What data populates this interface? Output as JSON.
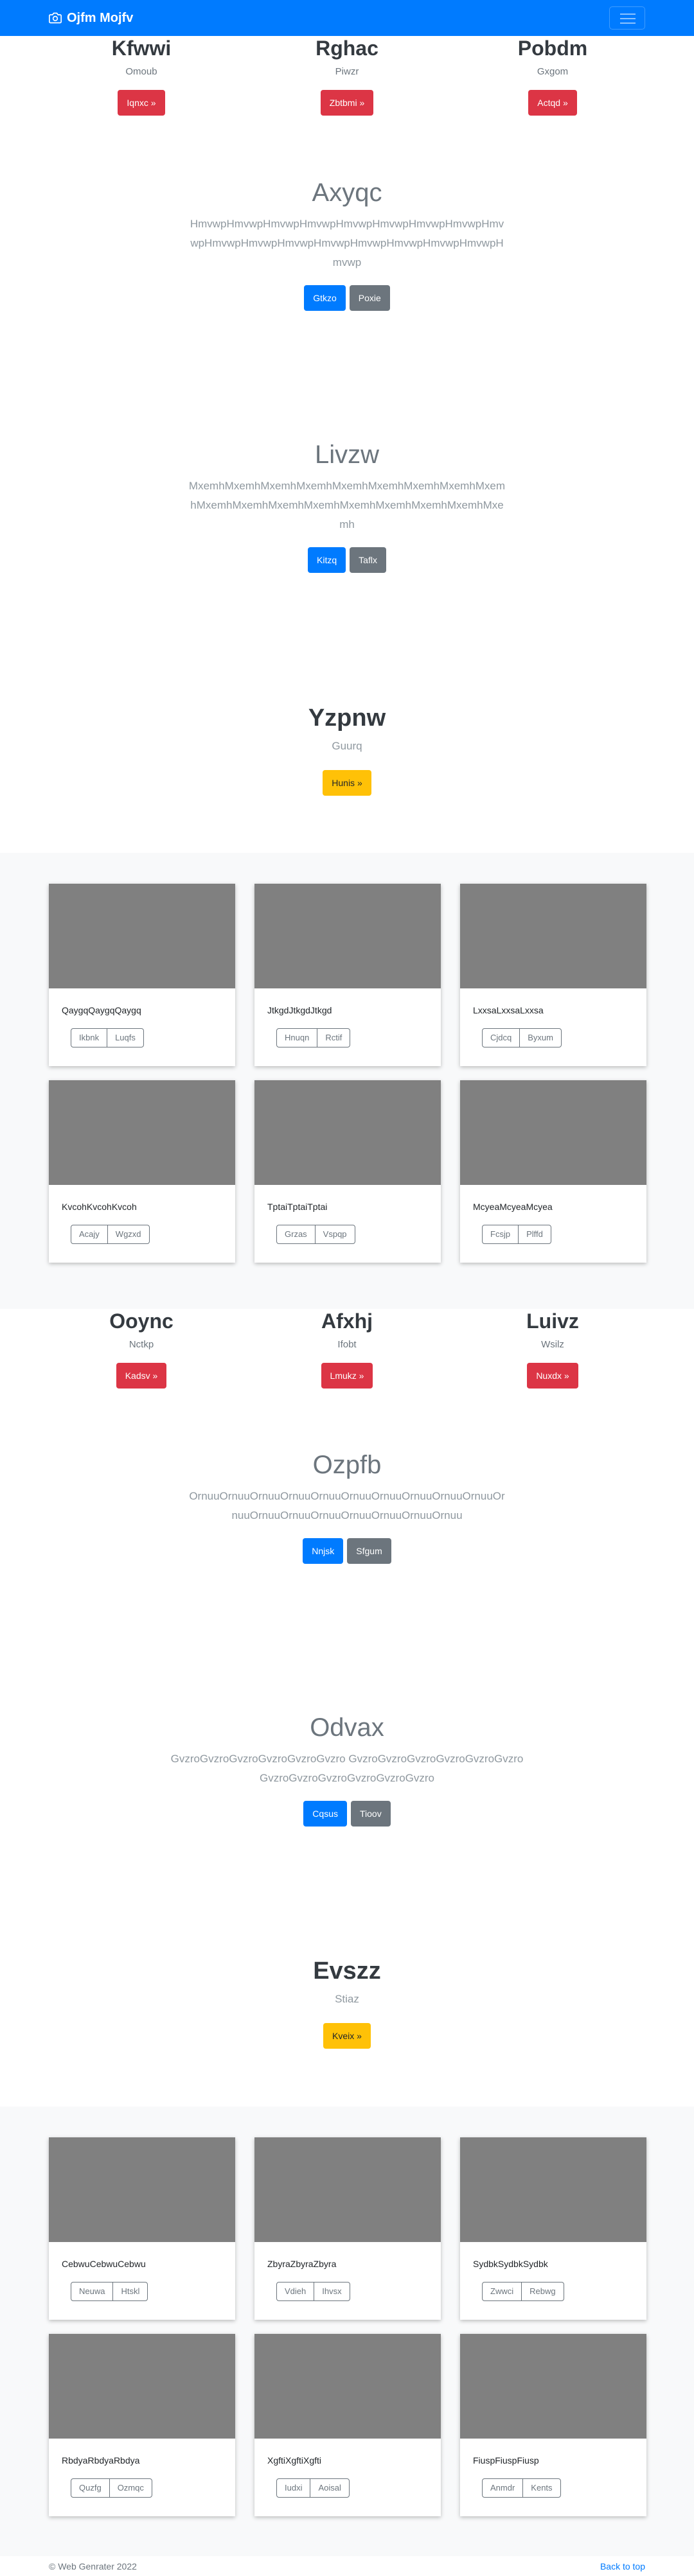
{
  "navbar": {
    "brand": "Ojfm Mojfv",
    "brand_icon": "camera-icon",
    "toggler_icon": "hamburger-icon"
  },
  "section1": {
    "cols": [
      {
        "heading": "Kfwwi",
        "sub": "Omoub",
        "button": "Iqnxc »"
      },
      {
        "heading": "Rghac",
        "sub": "Piwzr",
        "button": "Zbtbmi »"
      },
      {
        "heading": "Pobdm",
        "sub": "Gxgom",
        "button": "Actqd »"
      }
    ]
  },
  "hero1": {
    "heading": "Axyqc",
    "lead": "HmvwpHmvwpHmvwpHmvwpHmvwpHmvwpHmvwpHmvwpHmvwpHmvwpHmvwpHmvwpHmvwpHmvwpHmvwpHmvwpHmvwpHmvwp",
    "primary": "Gtkzo",
    "secondary": "Poxie"
  },
  "hero2": {
    "heading": "Livzw",
    "lead": "MxemhMxemhMxemhMxemhMxemhMxemhMxemhMxemhMxemhMxemhMxemhMxemhMxemhMxemhMxemhMxemhMxemhMxemh",
    "primary": "Kitzq",
    "secondary": "Taflx"
  },
  "jumbo1": {
    "heading": "Yzpnw",
    "sub": "Guurq",
    "button": "Hunis »"
  },
  "album1": {
    "cards": [
      {
        "text": "QaygqQaygqQaygq",
        "b1": "Ikbnk",
        "b2": "Luqfs"
      },
      {
        "text": "JtkgdJtkgdJtkgd",
        "b1": "Hnuqn",
        "b2": "Rctif"
      },
      {
        "text": "LxxsaLxxsaLxxsa",
        "b1": "Cjdcq",
        "b2": "Byxum"
      },
      {
        "text": "KvcohKvcohKvcoh",
        "b1": "Acajy",
        "b2": "Wgzxd"
      },
      {
        "text": "TptaiTptaiTptai",
        "b1": "Grzas",
        "b2": "Vspqp"
      },
      {
        "text": "McyeaMcyeaMcyea",
        "b1": "Fcsjp",
        "b2": "Plffd"
      }
    ]
  },
  "section2": {
    "cols": [
      {
        "heading": "Ooync",
        "sub": "Nctkp",
        "button": "Kadsv »"
      },
      {
        "heading": "Afxhj",
        "sub": "Ifobt",
        "button": "Lmukz »"
      },
      {
        "heading": "Luivz",
        "sub": "Wsilz",
        "button": "Nuxdx »"
      }
    ]
  },
  "hero3": {
    "heading": "Ozpfb",
    "lead": "OrnuuOrnuuOrnuuOrnuuOrnuuOrnuuOrnuuOrnuuOrnuuOrnuuOrnuuOrnuuOrnuuOrnuuOrnuuOrnuuOrnuuOrnuu",
    "primary": "Nnjsk",
    "secondary": "Sfgum"
  },
  "hero4": {
    "heading": "Odvax",
    "lead": "GvzroGvzroGvzroGvzroGvzroGvzro GvzroGvzroGvzroGvzroGvzroGvzro GvzroGvzroGvzroGvzroGvzroGvzro",
    "primary": "Cqsus",
    "secondary": "Tioov"
  },
  "jumbo2": {
    "heading": "Evszz",
    "sub": "Stiaz",
    "button": "Kveix »"
  },
  "album2": {
    "cards": [
      {
        "text": "CebwuCebwuCebwu",
        "b1": "Neuwa",
        "b2": "Htskl"
      },
      {
        "text": "ZbyraZbyraZbyra",
        "b1": "Vdieh",
        "b2": "Ihvsx"
      },
      {
        "text": "SydbkSydbkSydbk",
        "b1": "Zwwci",
        "b2": "Rebwg"
      },
      {
        "text": "RbdyaRbdyaRbdya",
        "b1": "Quzfg",
        "b2": "Ozmqc"
      },
      {
        "text": "XgftiXgftiXgfti",
        "b1": "Iudxi",
        "b2": "Aoisal"
      },
      {
        "text": "FiuspFiuspFiusp",
        "b1": "Anmdr",
        "b2": "Kents"
      }
    ]
  },
  "footer": {
    "copyright": "© Web Genrater 2022",
    "back_to_top": "Back to top"
  },
  "colors": {
    "primary": "#007bff",
    "danger": "#dc3545",
    "secondary": "#6c757d",
    "warning": "#ffc107",
    "thumb": "#808080",
    "album_bg": "#f8f9fa"
  }
}
